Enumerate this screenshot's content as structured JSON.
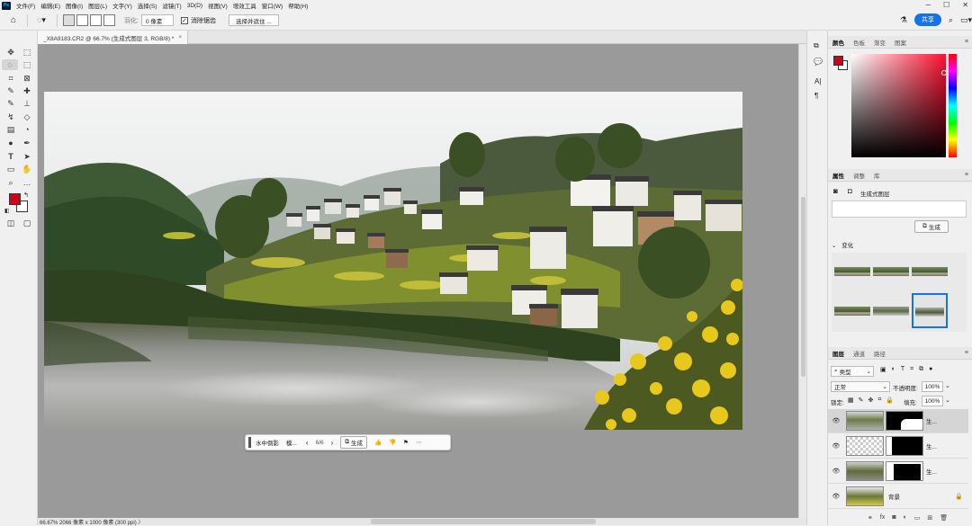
{
  "menubar": {
    "items": [
      "文件(F)",
      "编辑(E)",
      "图像(I)",
      "图层(L)",
      "文字(Y)",
      "选择(S)",
      "滤镜(T)",
      "3D(D)",
      "视图(V)",
      "增效工具",
      "窗口(W)",
      "帮助(H)"
    ]
  },
  "options": {
    "feather_label": "羽化:",
    "feather_value": "0 像素",
    "antialias_label": "消除锯齿",
    "antialias_checked": true,
    "select_subject_label": "选择并遮住 ...",
    "share_label": "共享"
  },
  "document": {
    "tab_title": "_X8A9183.CR2 @ 66.7% (生成式图层 3, RGB/8) *",
    "status": "66.67%    2066 像素 x 1000 像素 (300 ppi)  〉"
  },
  "context_bar": {
    "prompt": "水中倒影",
    "more": "模...",
    "counter": "6/6",
    "generate_label": "生成"
  },
  "color_panel": {
    "tabs": [
      "颜色",
      "色板",
      "渐变",
      "图案"
    ],
    "foreground": "#d0021b",
    "background": "#ffffff"
  },
  "properties_panel": {
    "tabs": [
      "属性",
      "调整",
      "库"
    ],
    "layer_type": "生成式图层",
    "generate_label": "生成",
    "variations_label": "变化"
  },
  "layers_panel": {
    "tabs": [
      "图层",
      "通道",
      "路径"
    ],
    "filter_kind": "类型",
    "blend_mode": "正常",
    "opacity_label": "不透明度:",
    "opacity_value": "100%",
    "lock_label": "锁定:",
    "fill_label": "填充:",
    "fill_value": "100%",
    "layers": [
      {
        "name": "生...",
        "selected": true
      },
      {
        "name": "生...",
        "selected": false
      },
      {
        "name": "生...",
        "selected": false
      },
      {
        "name": "背景",
        "selected": false
      }
    ]
  }
}
